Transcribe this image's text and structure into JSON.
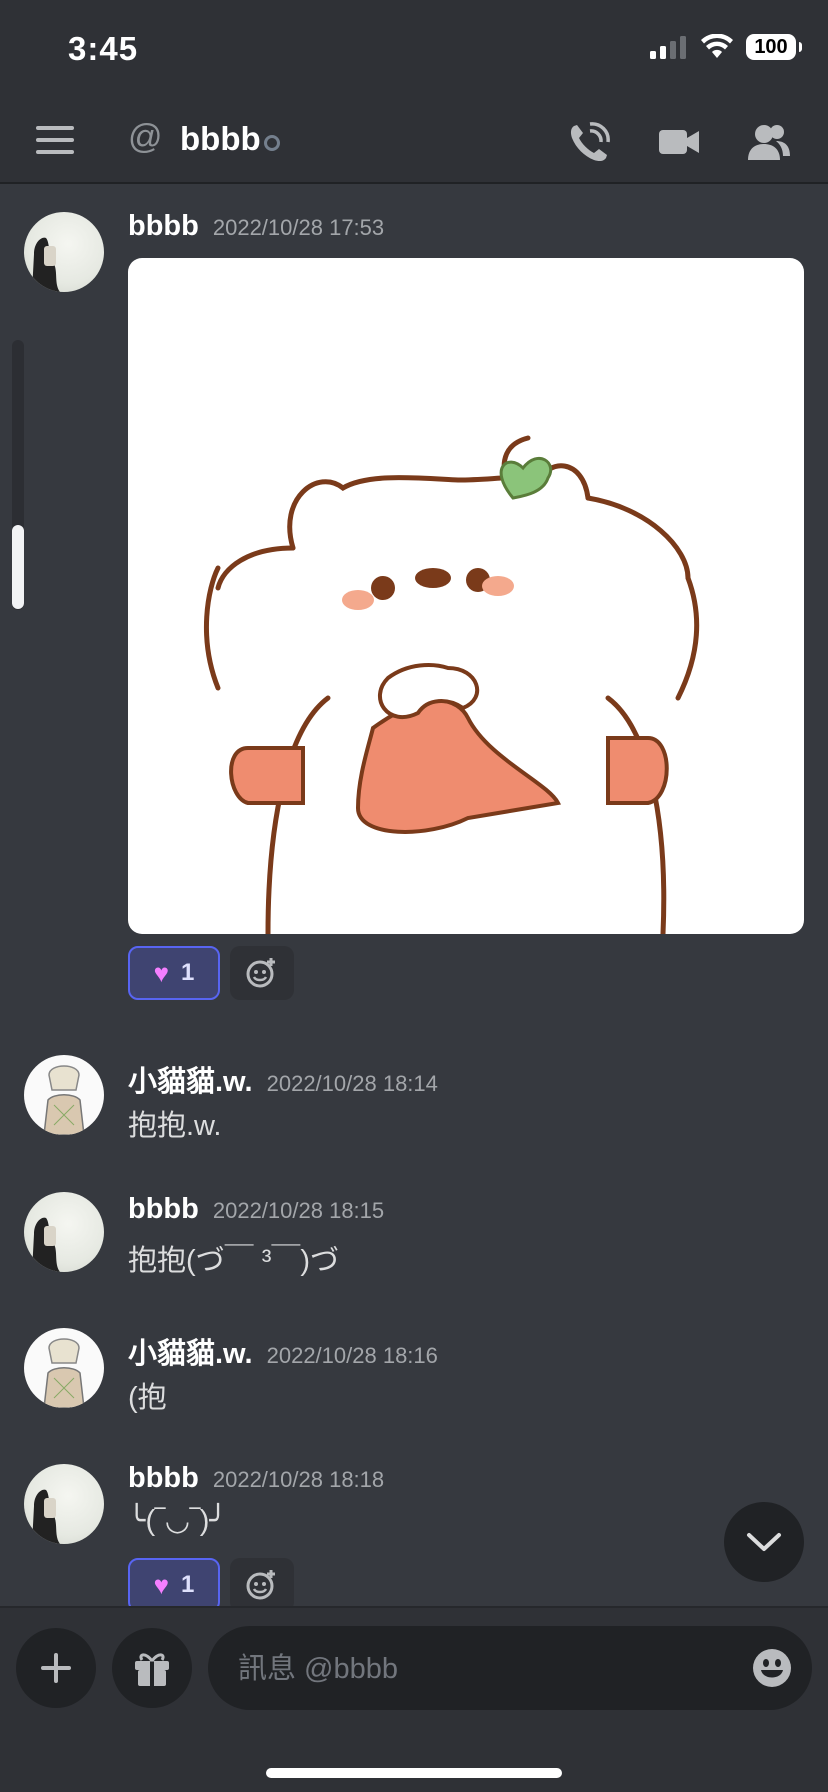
{
  "status_bar": {
    "time": "3:45",
    "battery": "100"
  },
  "header": {
    "channel_name": "bbbb"
  },
  "messages": [
    {
      "author": "bbbb",
      "timestamp": "2022/10/28 17:53",
      "text": "",
      "reaction": {
        "count": "1"
      }
    },
    {
      "author": "小貓貓.w.",
      "timestamp": "2022/10/28 18:14",
      "text": "抱抱.w."
    },
    {
      "author": "bbbb",
      "timestamp": "2022/10/28 18:15",
      "text": "抱抱(づ￣ ³￣)づ"
    },
    {
      "author": "小貓貓.w.",
      "timestamp": "2022/10/28 18:16",
      "text": "(抱"
    },
    {
      "author": "bbbb",
      "timestamp": "2022/10/28 18:18",
      "text": "╰(‾◡‾)╯",
      "reaction": {
        "count": "1"
      }
    }
  ],
  "composer": {
    "placeholder": "訊息 @bbbb"
  },
  "colors": {
    "background": "#36393f",
    "header": "#2f3136",
    "accent": "#5865f2"
  }
}
